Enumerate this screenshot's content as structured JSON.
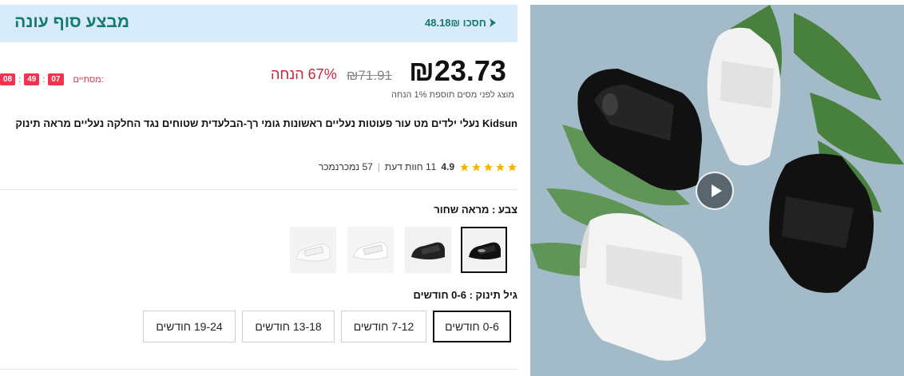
{
  "banner": {
    "title": "מבצע סוף עונה",
    "save_text": "48.18₪ חסכו"
  },
  "price": {
    "current": "₪23.73",
    "original": "₪71.91",
    "discount": "67% הנחה"
  },
  "timer": {
    "label": "מסתיים:",
    "hours": "07",
    "minutes": "49",
    "seconds": "08"
  },
  "tax_note": "מוצג לפני מסים תוספת 1% הנחה",
  "product": {
    "brand": "Kidsun",
    "title": "נעלי ילדים מט עור פעוטות נעליים ראשונות גומי רך-הבלעדית שטוחים נגד החלקה נעליים מראה תינוק"
  },
  "rating": {
    "score": "4.9",
    "reviews": "11 חוות דעת",
    "sold": "57 נמכרנמכר",
    "stars": 5
  },
  "color": {
    "label": "צבע : מראה שחור",
    "options": [
      "black-patent",
      "black-matte",
      "white-patent",
      "white-matte"
    ],
    "selected_index": 0
  },
  "size": {
    "label": "גיל תינוק : 0-6 חודשים",
    "options": [
      "0-6 חודשים",
      "7-12 חודשים",
      "13-18 חודשים",
      "19-24 חודשים"
    ],
    "selected_index": 0
  },
  "media": {
    "play_icon": "play-icon"
  },
  "colors": {
    "banner_bg": "#d7ebfb",
    "banner_text": "#157a6e",
    "discount_red": "#c8243f",
    "timer_red": "#f4324e",
    "star_yellow": "#f5b301"
  }
}
